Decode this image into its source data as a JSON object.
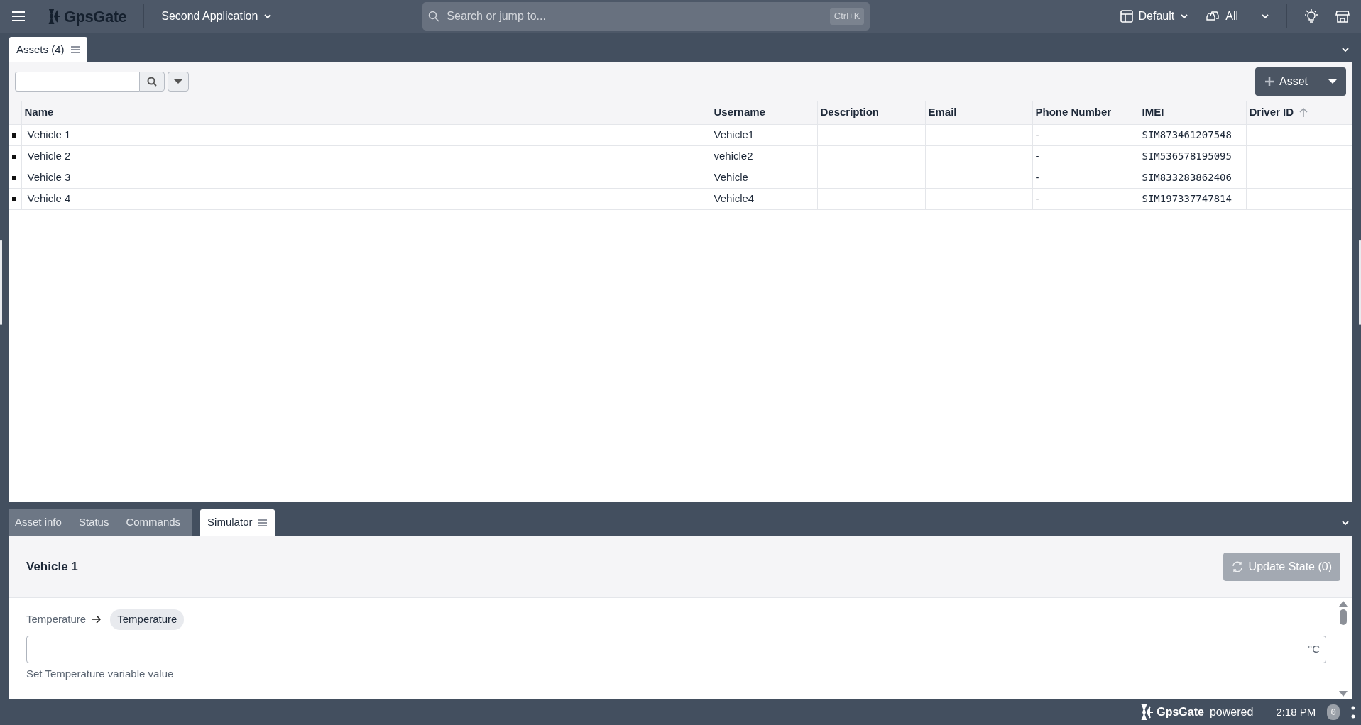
{
  "topbar": {
    "logo": "GpsGate",
    "application": "Second Application",
    "search": {
      "placeholder": "Search or jump to...",
      "shortcut": "Ctrl+K"
    },
    "view": "Default",
    "filter": "All"
  },
  "top_tabs": [
    {
      "label": "Assets (4)",
      "selected": true
    }
  ],
  "assets": {
    "add_button": "Asset",
    "table": {
      "columns": [
        {
          "label": "Name"
        },
        {
          "label": "Username"
        },
        {
          "label": "Description"
        },
        {
          "label": "Email"
        },
        {
          "label": "Phone Number"
        },
        {
          "label": "IMEI",
          "monospace": true
        },
        {
          "label": "Driver ID",
          "sorted": true
        }
      ],
      "rows": [
        {
          "cells": [
            "Vehicle 1",
            "Vehicle1",
            null,
            null,
            "-",
            "SIM873461207548",
            null
          ]
        },
        {
          "cells": [
            "Vehicle 2",
            "vehicle2",
            null,
            null,
            "-",
            "SIM536578195095",
            null
          ]
        },
        {
          "cells": [
            "Vehicle 3",
            "Vehicle",
            null,
            null,
            "-",
            "SIM833283862406",
            null
          ]
        },
        {
          "cells": [
            "Vehicle 4",
            "Vehicle4",
            null,
            null,
            "-",
            "SIM197337747814",
            null
          ]
        }
      ]
    }
  },
  "bottom_tabs": [
    {
      "label": "Asset info",
      "selected": false
    },
    {
      "label": "Status",
      "selected": false
    },
    {
      "label": "Commands",
      "selected": false
    },
    {
      "label": "Simulator",
      "selected": true
    }
  ],
  "simulator": {
    "title": "Vehicle 1",
    "update_button": {
      "label": "Update State (0)",
      "disabled": true
    },
    "variable": {
      "source": "Temperature",
      "target": "Temperature",
      "unit": "°C",
      "help": "Set Temperature variable value"
    }
  },
  "footer": {
    "logo": "GpsGate",
    "powered": "powered",
    "time": "2:18 PM",
    "badge": "0"
  }
}
